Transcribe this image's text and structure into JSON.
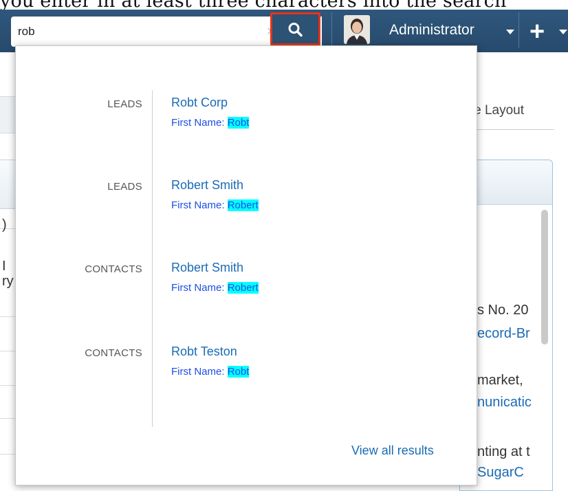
{
  "caption": {
    "text": "you enter in at least three characters into the search"
  },
  "header": {
    "search": {
      "value": "rob",
      "clear_glyph": "×"
    },
    "user": {
      "name": "Administrator"
    },
    "icons": {
      "search": "search-icon",
      "clear": "clear-icon",
      "user_caret": "caret-down-icon",
      "plus": "plus-icon",
      "plus_caret": "caret-down-icon"
    },
    "plus_glyph": "+",
    "colors": {
      "header_bg": "#2b4f72",
      "highlight_border": "#e53418"
    }
  },
  "results": [
    {
      "module": "LEADS",
      "name": "Robt Corp",
      "field_label": "First Name:",
      "field_value": "Robt"
    },
    {
      "module": "LEADS",
      "name": "Robert Smith",
      "field_label": "First Name:",
      "field_value": "Robert"
    },
    {
      "module": "CONTACTS",
      "name": "Robert Smith",
      "field_label": "First Name:",
      "field_value": "Robert"
    },
    {
      "module": "CONTACTS",
      "name": "Robt Teston",
      "field_label": "First Name:",
      "field_value": "Robt"
    }
  ],
  "view_all": "View all results",
  "background": {
    "change_layout": "nge Layout",
    "texts": [
      {
        "text": "s No. 20",
        "color": "#333333"
      },
      {
        "text": "ecord-Br",
        "color": "#1a6bb5"
      },
      {
        "text": "market,",
        "color": "#333333"
      },
      {
        "text": "nunicatic",
        "color": "#1a6bb5"
      },
      {
        "text": "nting at t",
        "color": "#333333"
      },
      {
        "text": "SugarC",
        "color": "#1a6bb5"
      }
    ],
    "left_glyphs": [
      ")",
      "I",
      "ry"
    ],
    "highlight_color": "#00ffff",
    "link_color": "#1a6bb5"
  }
}
